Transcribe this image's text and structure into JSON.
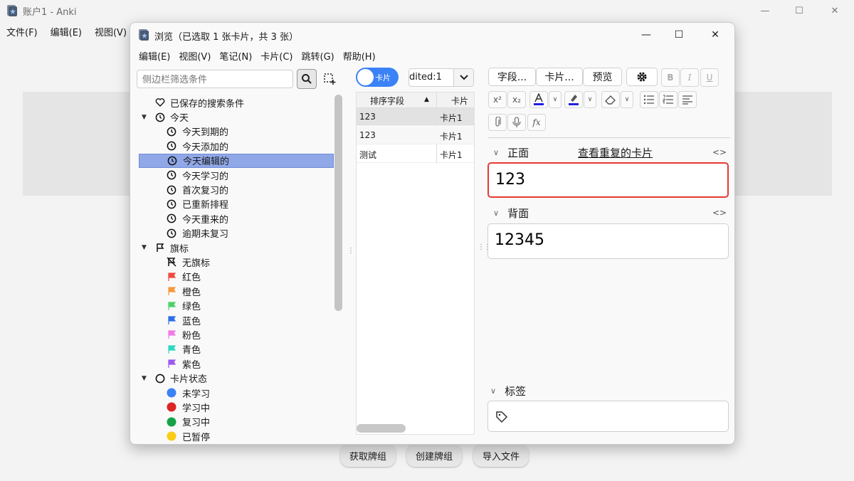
{
  "main_window": {
    "title": "账户1 - Anki",
    "menu": [
      "文件(F)",
      "编辑(E)",
      "视图(V)"
    ],
    "bottom_buttons": [
      "获取牌组",
      "创建牌组",
      "导入文件"
    ]
  },
  "browse": {
    "title": "浏览（已选取 1 张卡片，共 3 张）",
    "menu": [
      "编辑(E)",
      "视图(V)",
      "笔记(N)",
      "卡片(C)",
      "跳转(G)",
      "帮助(H)"
    ],
    "sidebar": {
      "search_placeholder": "侧边栏筛选条件",
      "saved_searches": "已保存的搜索条件",
      "today": {
        "label": "今天",
        "items": [
          "今天到期的",
          "今天添加的",
          "今天编辑的",
          "今天学习的",
          "首次复习的",
          "已重新排程",
          "今天重来的",
          "逾期未复习"
        ],
        "selected": "今天编辑的"
      },
      "flags": {
        "label": "旗标",
        "items": [
          {
            "label": "无旗标",
            "color": "#222222"
          },
          {
            "label": "红色",
            "color": "#f0493e"
          },
          {
            "label": "橙色",
            "color": "#f59a3b"
          },
          {
            "label": "绿色",
            "color": "#4cd16b"
          },
          {
            "label": "蓝色",
            "color": "#2f6fe8"
          },
          {
            "label": "粉色",
            "color": "#f27ae8"
          },
          {
            "label": "青色",
            "color": "#2fd6c2"
          },
          {
            "label": "紫色",
            "color": "#9b59f0"
          }
        ]
      },
      "card_state": {
        "label": "卡片状态",
        "items": [
          {
            "label": "未学习",
            "color": "#3b82f6"
          },
          {
            "label": "学习中",
            "color": "#dc2626"
          },
          {
            "label": "复习中",
            "color": "#16a34a"
          },
          {
            "label": "已暂停",
            "color": "#facc15"
          }
        ]
      }
    },
    "table": {
      "mode_toggle": "卡片",
      "search_value": "dited:1",
      "columns": [
        "排序字段",
        "卡片"
      ],
      "rows": [
        {
          "sort_field": "123",
          "card": "卡片1"
        },
        {
          "sort_field": "123",
          "card": "卡片1"
        },
        {
          "sort_field": "测试",
          "card": "卡片1"
        }
      ]
    },
    "editor": {
      "buttons": {
        "fields": "字段...",
        "cards": "卡片...",
        "preview": "预览"
      },
      "fields": [
        {
          "name": "正面",
          "value": "123"
        },
        {
          "name": "背面",
          "value": "12345"
        }
      ],
      "duplicate_link": "查看重复的卡片",
      "tags_label": "标签",
      "html_toggle": "<>"
    }
  }
}
